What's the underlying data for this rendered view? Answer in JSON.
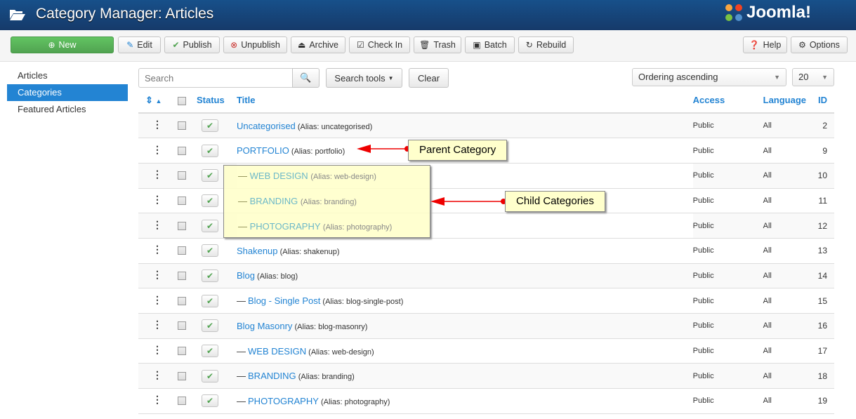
{
  "header": {
    "title": "Category Manager: Articles",
    "logo": "Joomla!",
    "icon": "folder-open-icon"
  },
  "toolbar": {
    "new": "New",
    "edit": "Edit",
    "publish": "Publish",
    "unpublish": "Unpublish",
    "archive": "Archive",
    "checkin": "Check In",
    "trash": "Trash",
    "batch": "Batch",
    "rebuild": "Rebuild",
    "help": "Help",
    "options": "Options"
  },
  "sidebar": {
    "items": [
      {
        "label": "Articles"
      },
      {
        "label": "Categories",
        "active": true
      },
      {
        "label": "Featured Articles"
      }
    ]
  },
  "filters": {
    "search_placeholder": "Search",
    "search_tools": "Search tools",
    "clear": "Clear",
    "ordering": "Ordering ascending",
    "limit": "20"
  },
  "table": {
    "headers": {
      "status": "Status",
      "title": "Title",
      "access": "Access",
      "language": "Language",
      "id": "ID"
    },
    "rows": [
      {
        "level": 0,
        "title": "Uncategorised",
        "alias": "(Alias: uncategorised)",
        "access": "Public",
        "language": "All",
        "id": "2"
      },
      {
        "level": 0,
        "title": "PORTFOLIO",
        "alias": "(Alias: portfolio)",
        "access": "Public",
        "language": "All",
        "id": "9"
      },
      {
        "level": 1,
        "title": "WEB DESIGN",
        "alias": "(Alias: web-design)",
        "access": "Public",
        "language": "All",
        "id": "10",
        "highlighted": true
      },
      {
        "level": 1,
        "title": "BRANDING",
        "alias": "(Alias: branding)",
        "access": "Public",
        "language": "All",
        "id": "11",
        "highlighted": true
      },
      {
        "level": 1,
        "title": "PHOTOGRAPHY",
        "alias": "(Alias: photography)",
        "access": "Public",
        "language": "All",
        "id": "12",
        "highlighted": true
      },
      {
        "level": 0,
        "title": "Shakenup",
        "alias": "(Alias: shakenup)",
        "access": "Public",
        "language": "All",
        "id": "13"
      },
      {
        "level": 0,
        "title": "Blog",
        "alias": "(Alias: blog)",
        "access": "Public",
        "language": "All",
        "id": "14"
      },
      {
        "level": 1,
        "title": "Blog - Single Post",
        "alias": "(Alias: blog-single-post)",
        "access": "Public",
        "language": "All",
        "id": "15"
      },
      {
        "level": 0,
        "title": "Blog Masonry",
        "alias": "(Alias: blog-masonry)",
        "access": "Public",
        "language": "All",
        "id": "16"
      },
      {
        "level": 1,
        "title": "WEB DESIGN",
        "alias": "(Alias: web-design)",
        "access": "Public",
        "language": "All",
        "id": "17"
      },
      {
        "level": 1,
        "title": "BRANDING",
        "alias": "(Alias: branding)",
        "access": "Public",
        "language": "All",
        "id": "18"
      },
      {
        "level": 1,
        "title": "PHOTOGRAPHY",
        "alias": "(Alias: photography)",
        "access": "Public",
        "language": "All",
        "id": "19"
      }
    ]
  },
  "annotations": {
    "parent": "Parent Category",
    "child": "Child Categories",
    "dash": "—"
  },
  "colors": {
    "header": "#17508a",
    "accent": "#2384d3",
    "new_button": "#5bb75b",
    "annotation_arrow": "#e00000",
    "callout_bg": "#ffffcc"
  }
}
